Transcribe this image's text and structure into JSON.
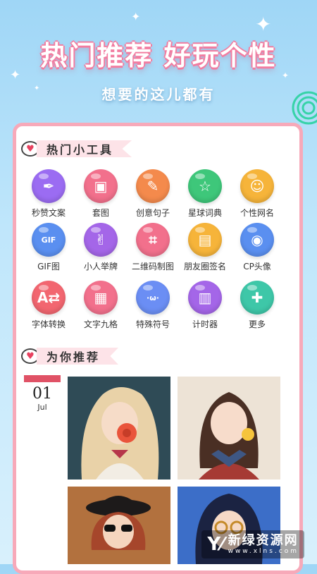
{
  "banner": {
    "headline": "热门推荐 好玩个性",
    "subline": "想要的这儿都有"
  },
  "sections": {
    "tools_title": "热门小工具",
    "recommend_title": "为你推荐"
  },
  "tools": [
    {
      "label": "秒赞文案",
      "icon": "feather-icon",
      "color": "#9b6cf2"
    },
    {
      "label": "套图",
      "icon": "image-icon",
      "color": "#f2708c"
    },
    {
      "label": "创意句子",
      "icon": "note-icon",
      "color": "#f48a4c"
    },
    {
      "label": "星球词典",
      "icon": "dictionary-icon",
      "color": "#3ec77a"
    },
    {
      "label": "个性网名",
      "icon": "user-card-icon",
      "color": "#f6b43a"
    },
    {
      "label": "GIF图",
      "icon": "gif-icon",
      "color": "#5a8ff0"
    },
    {
      "label": "小人举牌",
      "icon": "figure-sign-icon",
      "color": "#a466e8"
    },
    {
      "label": "二维码制图",
      "icon": "qr-scan-icon",
      "color": "#f2708c"
    },
    {
      "label": "朋友圈签名",
      "icon": "folder-icon",
      "color": "#f6b43a"
    },
    {
      "label": "CP头像",
      "icon": "couple-avatar-icon",
      "color": "#5a8ff0"
    },
    {
      "label": "字体转换",
      "icon": "font-convert-icon",
      "color": "#f26670"
    },
    {
      "label": "文字九格",
      "icon": "grid-icon",
      "color": "#f2708c"
    },
    {
      "label": "特殊符号",
      "icon": "symbol-icon",
      "color": "#6b8ef4"
    },
    {
      "label": "计时器",
      "icon": "calendar-icon",
      "color": "#a466e8"
    },
    {
      "label": "更多",
      "icon": "more-icon",
      "color": "#3ec7a8"
    }
  ],
  "date": {
    "day": "01",
    "month": "Jul"
  },
  "watermark": {
    "name": "新绿资源网",
    "url": "www.xlns.com"
  }
}
